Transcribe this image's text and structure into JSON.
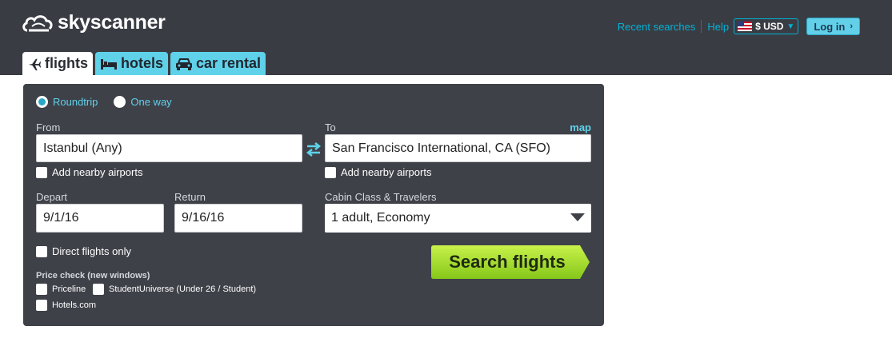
{
  "header": {
    "logo_text": "skyscanner",
    "links": {
      "recent": "Recent searches",
      "help": "Help"
    },
    "currency": "$ USD",
    "login": "Log in"
  },
  "tabs": [
    {
      "label": "flights",
      "icon": "plane-icon",
      "active": true
    },
    {
      "label": "hotels",
      "icon": "bed-icon",
      "active": false
    },
    {
      "label": "car rental",
      "icon": "car-icon",
      "active": false
    }
  ],
  "form": {
    "trip_type": {
      "roundtrip": "Roundtrip",
      "one_way": "One way",
      "selected": "Roundtrip"
    },
    "from": {
      "label": "From",
      "value": "Istanbul (Any)",
      "nearby": "Add nearby airports"
    },
    "to": {
      "label": "To",
      "value": "San Francisco International, CA (SFO)",
      "nearby": "Add nearby airports",
      "map": "map"
    },
    "depart": {
      "label": "Depart",
      "value": "9/1/16"
    },
    "return": {
      "label": "Return",
      "value": "9/16/16"
    },
    "cabin": {
      "label": "Cabin Class & Travelers",
      "value": "1 adult, Economy"
    },
    "direct": "Direct flights only",
    "price_check": {
      "title": "Price check (new windows)",
      "options": [
        "Priceline",
        "StudentUniverse (Under 26 / Student)",
        "Hotels.com"
      ]
    },
    "search_button": "Search flights"
  },
  "colors": {
    "header_bg": "#3a3c43",
    "panel_bg": "#3f4149",
    "accent": "#00b2d6",
    "tab_inactive": "#5fd2ea",
    "search_button": "#9fe02a"
  }
}
